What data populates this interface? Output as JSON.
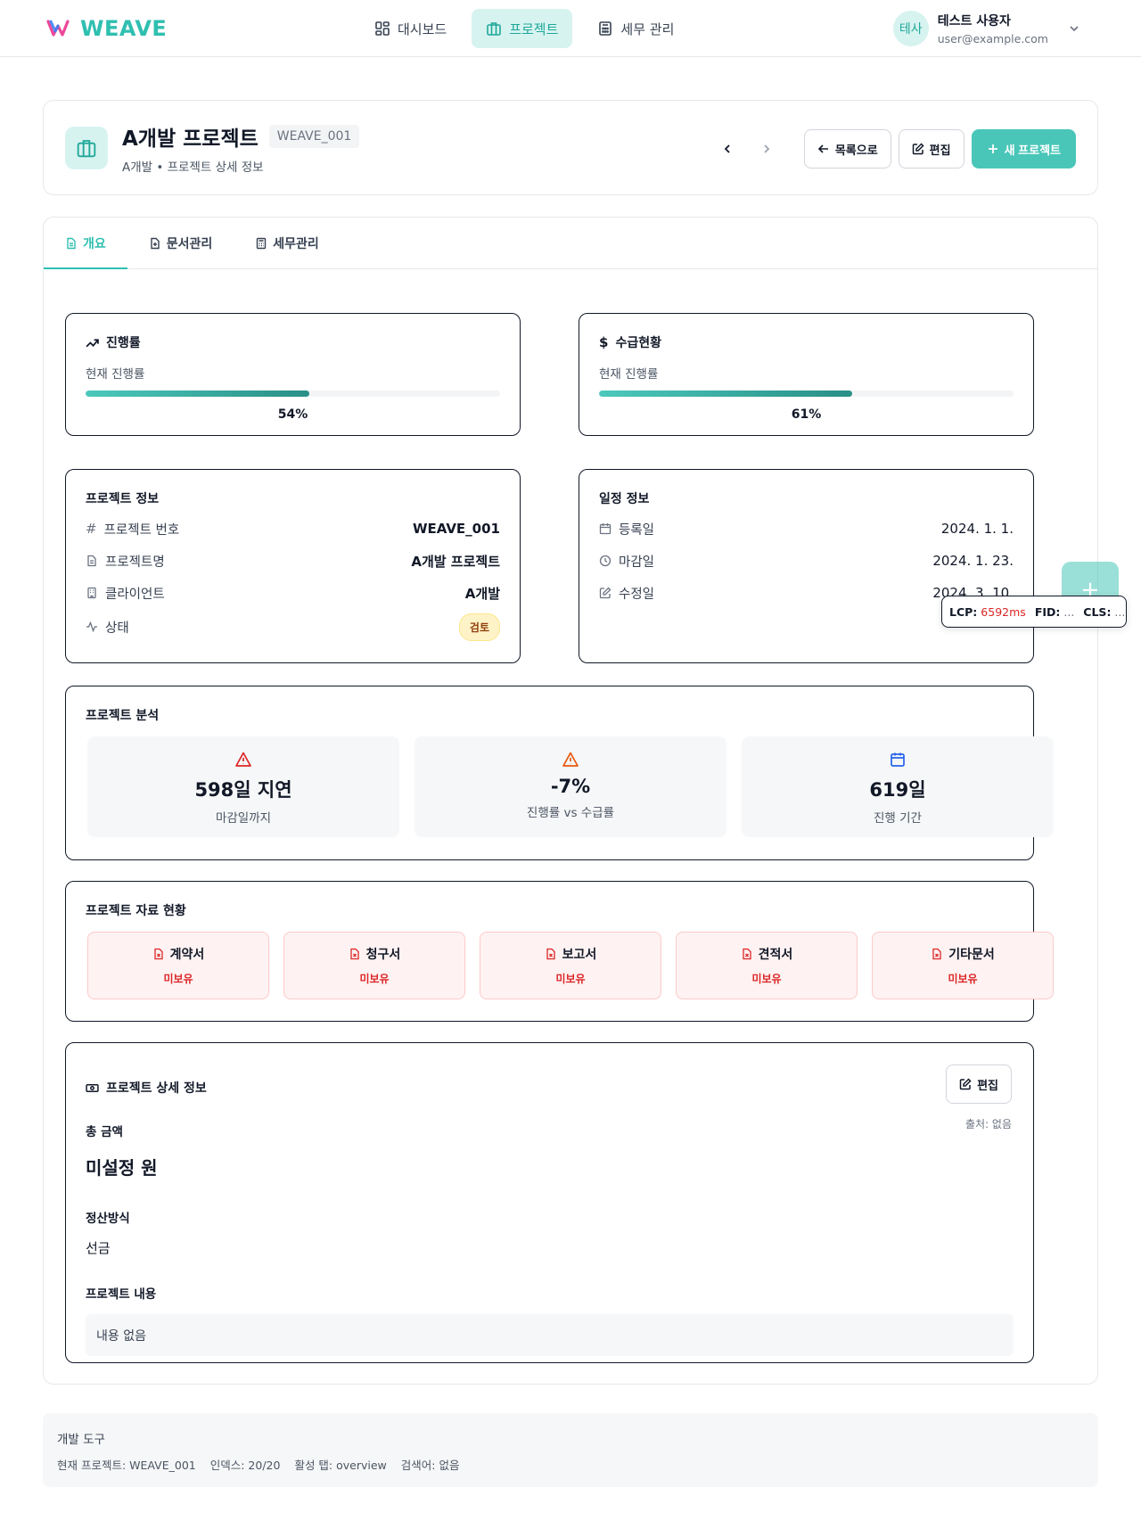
{
  "header": {
    "brand": "WEAVE",
    "nav": [
      {
        "label": "대시보드",
        "icon": "grid-icon"
      },
      {
        "label": "프로젝트",
        "icon": "briefcase-icon"
      },
      {
        "label": "세무 관리",
        "icon": "calculator-icon"
      }
    ],
    "user": {
      "avatar": "테사",
      "name": "테스트 사용자",
      "email": "user@example.com"
    }
  },
  "project": {
    "title": "A개발 프로젝트",
    "code": "WEAVE_001",
    "subtitle": "A개발 • 프로젝트 상세 정보",
    "actions": {
      "back": "목록으로",
      "edit": "편집",
      "new": "새 프로젝트"
    }
  },
  "tabs": [
    {
      "label": "개요",
      "icon": "document-icon"
    },
    {
      "label": "문서관리",
      "icon": "file-plus-icon"
    },
    {
      "label": "세무관리",
      "icon": "calculator-icon"
    }
  ],
  "progress": {
    "title": "진행률",
    "label": "현재 진행률",
    "value_text": "54%",
    "fraction": 0.54
  },
  "payment": {
    "title": "수급현황",
    "label": "현재 진행률",
    "value_text": "61%",
    "fraction": 0.61
  },
  "project_info": {
    "title": "프로젝트 정보",
    "rows": [
      {
        "key": "프로젝트 번호",
        "value": "WEAVE_001",
        "icon": "hash-icon"
      },
      {
        "key": "프로젝트명",
        "value": "A개발 프로젝트",
        "icon": "document-icon"
      },
      {
        "key": "클라이언트",
        "value": "A개발",
        "icon": "building-icon"
      },
      {
        "key": "상태",
        "value": "검토",
        "icon": "activity-icon"
      }
    ]
  },
  "schedule": {
    "title": "일정 정보",
    "rows": [
      {
        "key": "등록일",
        "value": "2024. 1. 1.",
        "icon": "calendar-icon"
      },
      {
        "key": "마감일",
        "value": "2024. 1. 23.",
        "icon": "clock-icon"
      },
      {
        "key": "수정일",
        "value": "2024. 3. 10.",
        "icon": "edit-icon"
      }
    ]
  },
  "analysis": {
    "title": "프로젝트 분석",
    "stats": [
      {
        "value": "598일 지연",
        "label": "마감일까지",
        "icon": "alert-triangle-icon",
        "color": "#dc2626"
      },
      {
        "value": "-7%",
        "label": "진행률 vs 수급률",
        "icon": "alert-triangle-icon",
        "color": "#ea580c"
      },
      {
        "value": "619일",
        "label": "진행 기간",
        "icon": "calendar-icon",
        "color": "#2563eb"
      }
    ]
  },
  "materials": {
    "title": "프로젝트 자료 현황",
    "docs": [
      {
        "name": "계약서",
        "status": "미보유"
      },
      {
        "name": "청구서",
        "status": "미보유"
      },
      {
        "name": "보고서",
        "status": "미보유"
      },
      {
        "name": "견적서",
        "status": "미보유"
      },
      {
        "name": "기타문서",
        "status": "미보유"
      }
    ]
  },
  "detail": {
    "title": "프로젝트 상세 정보",
    "edit": "편집",
    "total_label": "총 금액",
    "source": "출처: 없음",
    "total_value": "미설정 원",
    "settlement_label": "정산방식",
    "settlement_value": "선금",
    "content_label": "프로젝트 내용",
    "content_value": "내용 없음"
  },
  "dev_tools": {
    "title": "개발 도구",
    "items": [
      "현재 프로젝트: WEAVE_001",
      "인덱스: 20/20",
      "활성 탭: overview",
      "검색어: 없음"
    ]
  },
  "perf": {
    "lcp_label": "LCP:",
    "lcp_value": "6592ms",
    "fid_label": "FID:",
    "fid_value": "...",
    "cls_label": "CLS:",
    "cls_value": "..."
  },
  "fab": "+",
  "colors": {
    "accent": "#49c6b8",
    "danger": "#dc2626",
    "warning": "#ea580c",
    "info": "#2563eb"
  }
}
